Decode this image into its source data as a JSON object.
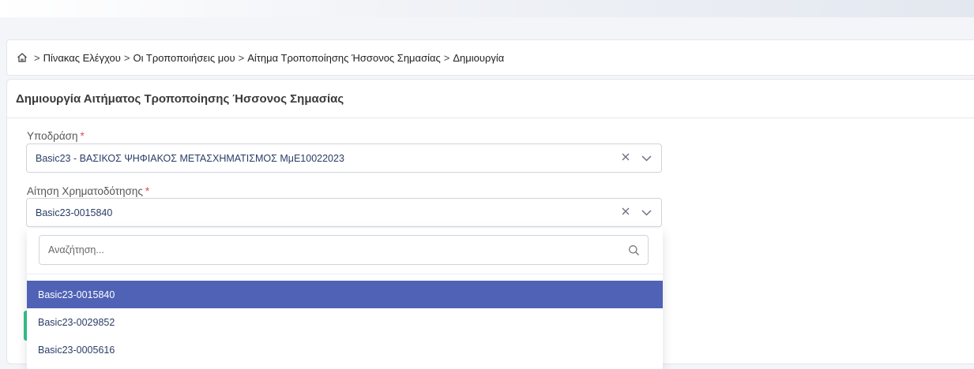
{
  "breadcrumb": {
    "items": [
      "Πίνακας Ελέγχου",
      "Οι Τροποποιήσεις μου",
      "Αίτημα Τροποποίησης Ήσσονος Σημασίας",
      "Δημιουργία"
    ],
    "separator": ">"
  },
  "card": {
    "title": "Δημιουργία Αιτήματος Τροποποίησης Ήσσονος Σημασίας"
  },
  "form": {
    "subaction": {
      "label": "Υποδράση",
      "required_mark": "*",
      "value": "Basic23 - ΒΑΣΙΚΟΣ ΨΗΦΙΑΚΟΣ ΜΕΤΑΣΧΗΜΑΤΙΣΜΟΣ ΜμΕ10022023"
    },
    "funding_application": {
      "label": "Αίτηση Χρηματοδότησης",
      "required_mark": "*",
      "value": "Basic23-0015840"
    }
  },
  "dropdown": {
    "search_placeholder": "Αναζήτηση...",
    "options": [
      {
        "label": "Basic23-0015840",
        "selected": true
      },
      {
        "label": "Basic23-0029852",
        "selected": false
      },
      {
        "label": "Basic23-0005616",
        "selected": false
      }
    ]
  },
  "icons": {
    "home": "home-icon",
    "clear": "close-icon",
    "expand": "chevron-down-icon",
    "search": "search-icon"
  },
  "colors": {
    "selected_option_bg": "#4f62b6",
    "required_mark": "#e0485a",
    "accent_green": "#35c38a"
  }
}
